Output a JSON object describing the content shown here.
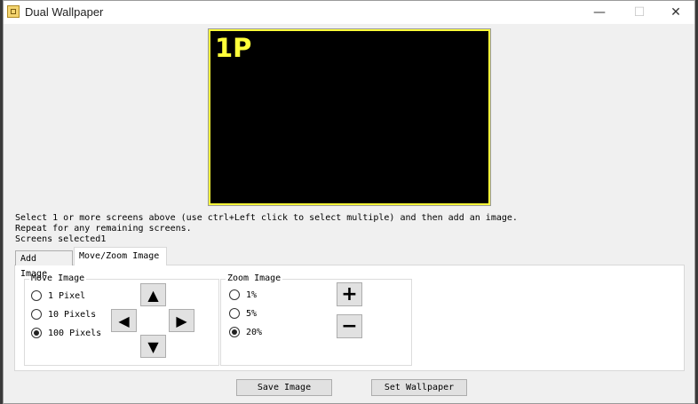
{
  "window": {
    "title": "Dual Wallpaper",
    "minimize": "—",
    "maximize": "☐",
    "close": "✕"
  },
  "preview": {
    "screen_label": "1P",
    "border_color": "#ffff3a"
  },
  "info": {
    "line1": "Select 1 or more screens above (use ctrl+Left click to select multiple) and then add an image.",
    "line2": "Repeat for any remaining screens.",
    "line3": "Screens selected1"
  },
  "tabs": [
    {
      "label": "Add Image",
      "active": false
    },
    {
      "label": "Move/Zoom Image",
      "active": true
    }
  ],
  "move_group": {
    "label": "Move Image",
    "options": [
      {
        "label": "1 Pixel",
        "checked": false
      },
      {
        "label": "10 Pixels",
        "checked": false
      },
      {
        "label": "100 Pixels",
        "checked": true
      }
    ],
    "arrows": {
      "up": "▲",
      "left": "◀",
      "right": "▶",
      "down": "▼"
    }
  },
  "zoom_group": {
    "label": "Zoom Image",
    "options": [
      {
        "label": "1%",
        "checked": false
      },
      {
        "label": "5%",
        "checked": false
      },
      {
        "label": "20%",
        "checked": true
      }
    ],
    "plus": "+",
    "minus": "−"
  },
  "buttons": {
    "save": "Save Image",
    "set": "Set Wallpaper"
  }
}
